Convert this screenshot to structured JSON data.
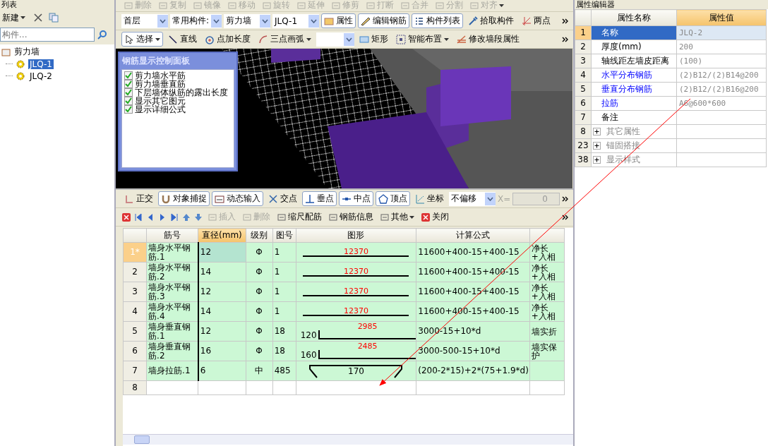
{
  "left_panel": {
    "title": "列表",
    "new_label": "新建",
    "search": {
      "placeholder": "构件..."
    },
    "tree": [
      {
        "label": "剪力墙",
        "children": [
          {
            "label": "JLQ-1",
            "selected": true
          },
          {
            "label": "JLQ-2",
            "selected": false
          }
        ]
      }
    ]
  },
  "edit_toolbar": [
    {
      "label": "删除",
      "disabled": true,
      "dropdown": false
    },
    {
      "label": "复制",
      "disabled": true,
      "dropdown": false
    },
    {
      "label": "镜像",
      "disabled": true,
      "dropdown": false
    },
    {
      "label": "移动",
      "disabled": true,
      "dropdown": false
    },
    {
      "label": "旋转",
      "disabled": true,
      "dropdown": false
    },
    {
      "label": "延伸",
      "disabled": true,
      "dropdown": false
    },
    {
      "label": "修剪",
      "disabled": true,
      "dropdown": false
    },
    {
      "label": "打断",
      "disabled": true,
      "dropdown": false
    },
    {
      "label": "合并",
      "disabled": true,
      "dropdown": false
    },
    {
      "label": "分割",
      "disabled": true,
      "dropdown": false
    },
    {
      "label": "对齐",
      "disabled": true,
      "dropdown": true
    }
  ],
  "selector_bar": {
    "dropdowns": [
      "首层",
      "常用构件:",
      "剪力墙",
      "JLQ-1"
    ],
    "buttons": [
      {
        "label": "属性",
        "pressed": true
      },
      {
        "label": "编辑钢筋",
        "pressed": true
      },
      {
        "label": "构件列表",
        "pressed": true
      },
      {
        "label": "拾取构件",
        "pressed": false
      },
      {
        "label": "两点",
        "pressed": false
      }
    ]
  },
  "draw_bar": [
    {
      "kind": "button",
      "label": "选择",
      "pressed": true,
      "dropdown": true
    },
    {
      "kind": "button",
      "label": "直线",
      "pressed": false,
      "dropdown": false
    },
    {
      "kind": "button",
      "label": "点加长度",
      "pressed": false,
      "dropdown": false
    },
    {
      "kind": "button",
      "label": "三点画弧",
      "pressed": false,
      "dropdown": true
    },
    {
      "kind": "combo"
    },
    {
      "kind": "button",
      "label": "矩形",
      "pressed": false,
      "dropdown": false
    },
    {
      "kind": "button",
      "label": "智能布置",
      "pressed": false,
      "dropdown": true
    },
    {
      "kind": "button",
      "label": "修改墙段属性",
      "pressed": false,
      "dropdown": false
    }
  ],
  "rebar_panel": {
    "title": "钢筋显示控制面板",
    "options": [
      {
        "label": "剪力墙水平筋",
        "checked": true
      },
      {
        "label": "剪力墙垂直筋",
        "checked": true
      },
      {
        "label": "下层墙体纵筋的露出长度",
        "checked": true
      },
      {
        "label": "显示其它图元",
        "checked": true
      },
      {
        "label": "显示详细公式",
        "checked": true
      }
    ]
  },
  "snap_bar": {
    "items": [
      {
        "label": "正交",
        "pressed": false
      },
      {
        "label": "对象捕捉",
        "pressed": true
      },
      {
        "label": "动态输入",
        "pressed": true
      },
      {
        "label": "交点",
        "pressed": false
      },
      {
        "label": "垂点",
        "pressed": true
      },
      {
        "label": "中点",
        "pressed": true
      },
      {
        "label": "顶点",
        "pressed": true
      },
      {
        "label": "坐标",
        "pressed": false
      }
    ],
    "offset": "不偏移",
    "x_label": "X=",
    "x_value": "0"
  },
  "table_bar": [
    {
      "label": "插入",
      "disabled": true,
      "dropdown": false
    },
    {
      "label": "删除",
      "disabled": true,
      "dropdown": false
    },
    {
      "label": "缩尺配筋",
      "disabled": false,
      "dropdown": false
    },
    {
      "label": "钢筋信息",
      "disabled": false,
      "dropdown": false
    },
    {
      "label": "其他",
      "disabled": false,
      "dropdown": true
    },
    {
      "label": "关闭",
      "disabled": false,
      "dropdown": false
    }
  ],
  "rebar_table": {
    "columns": [
      {
        "label": "筋号",
        "selected": false
      },
      {
        "label": "直径(mm)",
        "selected": true
      },
      {
        "label": "级别",
        "selected": false
      },
      {
        "label": "图号",
        "selected": false
      },
      {
        "label": "图形",
        "selected": false
      },
      {
        "label": "计算公式",
        "selected": false
      }
    ],
    "rows": [
      {
        "index": "1*",
        "selected": true,
        "name": "墙身水平钢筋.1",
        "diameter": "12",
        "grade": "Φ",
        "shape_no": "1",
        "shape": {
          "kind": "straight",
          "length": "12370"
        },
        "formula": "11600+400-15+400-15",
        "column_8": "净长+入相"
      },
      {
        "index": "2",
        "selected": false,
        "name": "墙身水平钢筋.2",
        "diameter": "14",
        "grade": "Φ",
        "shape_no": "1",
        "shape": {
          "kind": "straight",
          "length": "12370"
        },
        "formula": "11600+400-15+400-15",
        "column_8": "净长+入相"
      },
      {
        "index": "3",
        "selected": false,
        "name": "墙身水平钢筋.3",
        "diameter": "12",
        "grade": "Φ",
        "shape_no": "1",
        "shape": {
          "kind": "straight",
          "length": "12370"
        },
        "formula": "11600+400-15+400-15",
        "column_8": "净长+入相"
      },
      {
        "index": "4",
        "selected": false,
        "name": "墙身水平钢筋.4",
        "diameter": "14",
        "grade": "Φ",
        "shape_no": "1",
        "shape": {
          "kind": "straight",
          "length": "12370"
        },
        "formula": "11600+400-15+400-15",
        "column_8": "净长+入相"
      },
      {
        "index": "5",
        "selected": false,
        "name": "墙身垂直钢筋.1",
        "diameter": "12",
        "grade": "Φ",
        "shape_no": "18",
        "shape": {
          "kind": "bent",
          "length": "2985",
          "leg": "120"
        },
        "formula": "3000-15+10*d",
        "column_8": "墙实折"
      },
      {
        "index": "6",
        "selected": false,
        "name": "墙身垂直钢筋.2",
        "diameter": "16",
        "grade": "Φ",
        "shape_no": "18",
        "shape": {
          "kind": "bent",
          "length": "2485",
          "leg": "160"
        },
        "formula": "3000-500-15+10*d",
        "column_8": "墙实保护"
      },
      {
        "index": "7",
        "selected": false,
        "name": "墙身拉筋.1",
        "diameter": "6",
        "grade": "中",
        "shape_no": "485",
        "shape": {
          "kind": "hook",
          "length": "170"
        },
        "formula": "(200-2*15)+2*(75+1.9*d)"
      },
      {
        "index": "8",
        "selected": false
      }
    ]
  },
  "properties": {
    "title": "属性编辑器",
    "columns": [
      "属性名称",
      "属性值"
    ],
    "rows": [
      {
        "index": "1",
        "kind": "plain",
        "name": "名称",
        "value": "JLQ-2",
        "selected": true
      },
      {
        "index": "2",
        "kind": "plain",
        "name": "厚度(mm)",
        "value": "200",
        "selected": false
      },
      {
        "index": "3",
        "kind": "plain",
        "name": "轴线距左墙皮距离",
        "value": "(100)",
        "selected": false
      },
      {
        "index": "4",
        "kind": "link",
        "name": "水平分布钢筋",
        "value": "(2)B12/(2)B14@200",
        "selected": false
      },
      {
        "index": "5",
        "kind": "link",
        "name": "垂直分布钢筋",
        "value": "(2)B12/(2)B16@200",
        "selected": false
      },
      {
        "index": "6",
        "kind": "link",
        "name": "拉筋",
        "value": "A6@600*600",
        "selected": false
      },
      {
        "index": "7",
        "kind": "plain",
        "name": "备注",
        "selected": false
      },
      {
        "index": "8",
        "kind": "group",
        "name": "其它属性",
        "selected": false
      },
      {
        "index": "23",
        "kind": "group",
        "name": "锚固搭接",
        "selected": false
      },
      {
        "index": "38",
        "kind": "group",
        "name": "显示样式",
        "selected": false
      }
    ]
  }
}
